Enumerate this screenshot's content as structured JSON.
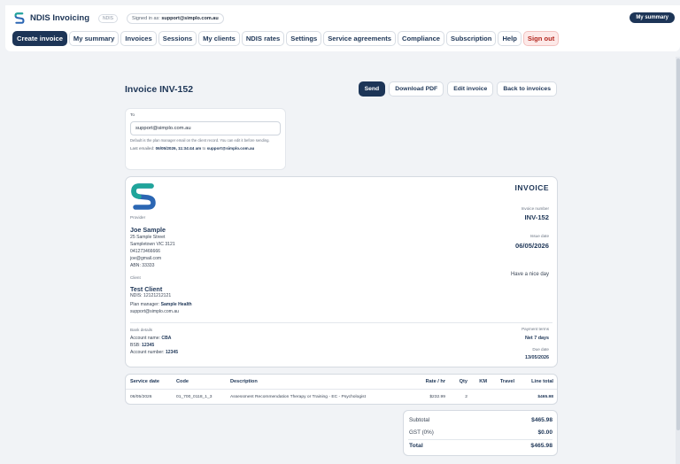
{
  "header": {
    "app_title": "NDIS Invoicing",
    "badge": "NDIS",
    "signed_in_label": "Signed in as:",
    "signed_in_email": "support@simplo.com.au",
    "my_summary_button": "My summary"
  },
  "nav": [
    {
      "label": "Create invoice",
      "name": "nav-create-invoice"
    },
    {
      "label": "My summary",
      "name": "nav-my-summary"
    },
    {
      "label": "Invoices",
      "name": "nav-invoices"
    },
    {
      "label": "Sessions",
      "name": "nav-sessions"
    },
    {
      "label": "My clients",
      "name": "nav-my-clients"
    },
    {
      "label": "NDIS rates",
      "name": "nav-ndis-rates"
    },
    {
      "label": "Settings",
      "name": "nav-settings"
    },
    {
      "label": "Service agreements",
      "name": "nav-service-agreements"
    },
    {
      "label": "Compliance",
      "name": "nav-compliance"
    },
    {
      "label": "Subscription",
      "name": "nav-subscription"
    },
    {
      "label": "Help",
      "name": "nav-help"
    },
    {
      "label": "Sign out",
      "name": "nav-sign-out"
    }
  ],
  "page": {
    "title": "Invoice INV-152",
    "actions": {
      "send": "Send",
      "download_pdf": "Download PDF",
      "edit_invoice": "Edit invoice",
      "back": "Back to invoices"
    }
  },
  "to_card": {
    "label": "To",
    "email": "support@simplo.com.au",
    "help_text": "Default is the plan manager email on the client record. You can edit it before sending.",
    "last_emailed_label": "Last emailed:",
    "last_emailed_time": "06/05/2026, 11:34:44 am",
    "last_emailed_to_word": "to",
    "last_emailed_to": "support@simplo.com.au"
  },
  "invoice": {
    "heading": "INVOICE",
    "provider_label": "Provider",
    "provider_name": "Joe Sample",
    "provider_address1": "25 Sample Street",
    "provider_address2": "Sampletown VIC 3121",
    "provider_phone": "041273466666",
    "provider_email": "joe@gmail.com",
    "provider_abn": "ABN: 33333",
    "client_label": "Client",
    "client_name": "Test Client",
    "client_ndis": "NDIS: 12121212121",
    "plan_manager_label": "Plan manager:",
    "plan_manager": "Sample Health",
    "plan_manager_email": "support@simplo.com.au",
    "invoice_number_label": "Invoice number",
    "invoice_number": "INV-152",
    "issue_date_label": "Issue date",
    "issue_date": "06/05/2026",
    "note": "Have a nice day",
    "bank_label": "Bank details",
    "account_name_label": "Account name:",
    "account_name": "CBA",
    "bsb_label": "BSB:",
    "bsb": "12345",
    "account_number_label": "Account number:",
    "account_number": "12345",
    "payment_terms_label": "Payment terms",
    "payment_terms": "Net 7 days",
    "due_date_label": "Due date",
    "due_date": "13/05/2026"
  },
  "table": {
    "headers": {
      "service_date": "Service date",
      "code": "Code",
      "description": "Description",
      "rate": "Rate / hr",
      "qty": "Qty",
      "km": "KM",
      "travel": "Travel",
      "line_total": "Line total"
    },
    "rows": [
      {
        "service_date": "06/05/2026",
        "code": "01_700_0118_1_3",
        "description": "Assessment Recommendation Therapy or Training - EC - Psychologist",
        "rate": "$232.99",
        "qty": "2",
        "km": "",
        "travel": "",
        "line_total": "$465.98"
      }
    ]
  },
  "totals": {
    "subtotal_label": "Subtotal",
    "subtotal": "$465.98",
    "gst_label": "GST (0%)",
    "gst": "$0.00",
    "total_label": "Total",
    "total": "$465.98"
  },
  "colors": {
    "primary": "#1d3557",
    "logo_teal": "#1fa59a",
    "logo_blue": "#2b66b3",
    "signout_bg": "#fde9e8"
  }
}
